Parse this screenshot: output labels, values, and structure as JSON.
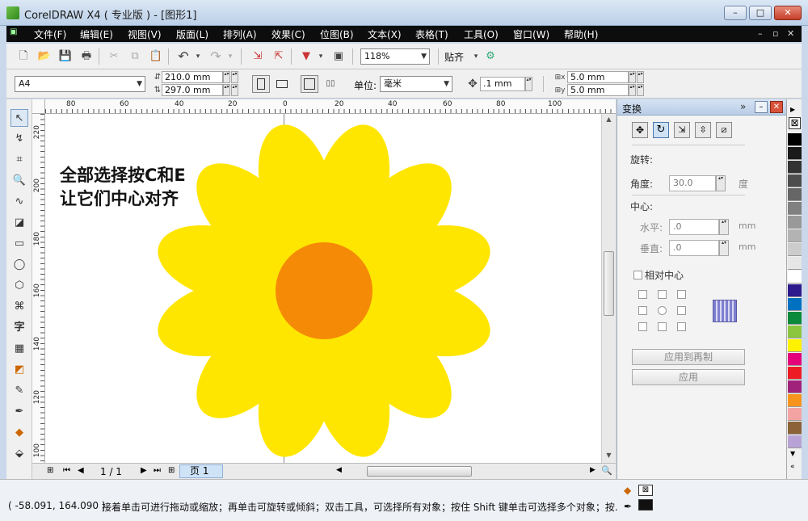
{
  "window": {
    "title": "CorelDRAW X4 ( 专业版 ) - [图形1]"
  },
  "menu": {
    "items": [
      "文件(F)",
      "编辑(E)",
      "视图(V)",
      "版面(L)",
      "排列(A)",
      "效果(C)",
      "位图(B)",
      "文本(X)",
      "表格(T)",
      "工具(O)",
      "窗口(W)",
      "帮助(H)"
    ]
  },
  "toolbar": {
    "zoom": "118%",
    "snap": "贴齐"
  },
  "property_bar": {
    "paper": "A4",
    "width": "210.0 mm",
    "height": "297.0 mm",
    "unit_label": "单位:",
    "unit": "毫米",
    "nudge": ".1 mm",
    "dup_x": "5.0 mm",
    "dup_y": "5.0 mm"
  },
  "rulers": {
    "h_labels": [
      "80",
      "60",
      "40",
      "20",
      "0",
      "20",
      "40",
      "60",
      "80",
      "100"
    ],
    "v_labels": [
      "220",
      "200",
      "180",
      "160",
      "140",
      "120",
      "100"
    ]
  },
  "canvas": {
    "annotation_line1": "全部选择按C和E",
    "annotation_line2": "让它们中心对齐",
    "petal_color": "#FFE600",
    "center_color": "#F58A07"
  },
  "page_nav": {
    "counter": "1 / 1",
    "tab": "页 1"
  },
  "docker": {
    "title": "变换",
    "rotate_heading": "旋转:",
    "angle_label": "角度:",
    "angle_value": "30.0",
    "angle_unit": "度",
    "center_heading": "中心:",
    "h_label": "水平:",
    "h_value": ".0",
    "v_label": "垂直:",
    "v_value": ".0",
    "mm1": "mm",
    "mm2": "mm",
    "relative_center": "相对中心",
    "apply_to_dup": "应用到再制",
    "apply": "应用"
  },
  "palette": {
    "colors": [
      "#000000",
      "#1a1a1a",
      "#333333",
      "#4d4d4d",
      "#666666",
      "#808080",
      "#999999",
      "#b3b3b3",
      "#cccccc",
      "#e6e6e6",
      "#ffffff",
      "#2e1a8c",
      "#0070c0",
      "#0a8a3a",
      "#8cc63f",
      "#fff200",
      "#e3007a",
      "#ed1c24",
      "#a0227b",
      "#f7941d",
      "#f4a3a3",
      "#8c6239",
      "#b9a3d6"
    ]
  },
  "status": {
    "coords": "( -58.091, 164.090 )",
    "hint": "接着单击可进行拖动或缩放；再单击可旋转或倾斜；双击工具，可选择所有对象；按住 Shift 键单击可选择多个对象；按..."
  }
}
